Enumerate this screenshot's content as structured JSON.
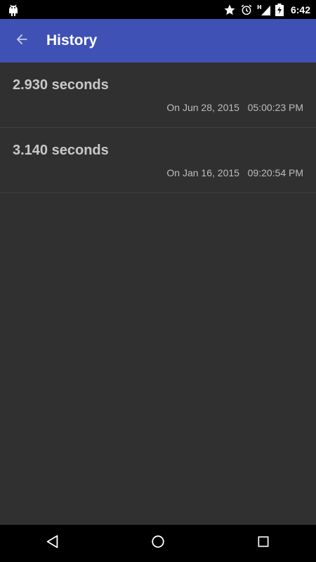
{
  "status_bar": {
    "time": "6:42",
    "icons": [
      "android-icon",
      "star-icon",
      "alarm-icon",
      "signal-h-icon",
      "battery-charging-icon"
    ]
  },
  "app_bar": {
    "title": "History",
    "back_icon": "arrow-back-icon",
    "color": "#3f51b5"
  },
  "history": {
    "items": [
      {
        "duration": "2.930 seconds",
        "date": "On Jun 28, 2015",
        "time": "05:00:23 PM"
      },
      {
        "duration": "3.140 seconds",
        "date": "On Jan 16, 2015",
        "time": "09:20:54 PM"
      }
    ]
  },
  "nav_bar": {
    "icons": [
      "back-triangle-icon",
      "home-circle-icon",
      "recents-square-icon"
    ]
  }
}
